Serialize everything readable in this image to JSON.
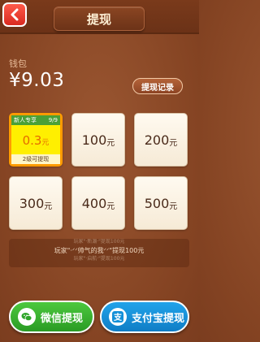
{
  "header": {
    "title": "提现"
  },
  "wallet": {
    "label": "钱包",
    "balance": "¥9.03",
    "history_label": "提现记录"
  },
  "options": [
    {
      "amount": "0.3",
      "unit": "元",
      "badge_left": "新人专享",
      "badge_right": "9/9",
      "footer": "2级可提现"
    },
    {
      "amount": "100",
      "unit": "元"
    },
    {
      "amount": "200",
      "unit": "元"
    },
    {
      "amount": "300",
      "unit": "元"
    },
    {
      "amount": "400",
      "unit": "元"
    },
    {
      "amount": "500",
      "unit": "元"
    }
  ],
  "ticker": {
    "line1": "玩家\"·新潮·\"提现100元",
    "line2": "玩家\"·ᐟᐟ帅气的我ᐟᐟ\"提现100元",
    "line3": "玩家\"·启航·\"提现100元"
  },
  "actions": {
    "wechat_label": "微信提现",
    "alipay_label": "支付宝提现"
  },
  "colors": {
    "accent_orange": "#ff9b00",
    "wechat_green": "#2fa52a",
    "alipay_blue": "#1490d8"
  }
}
